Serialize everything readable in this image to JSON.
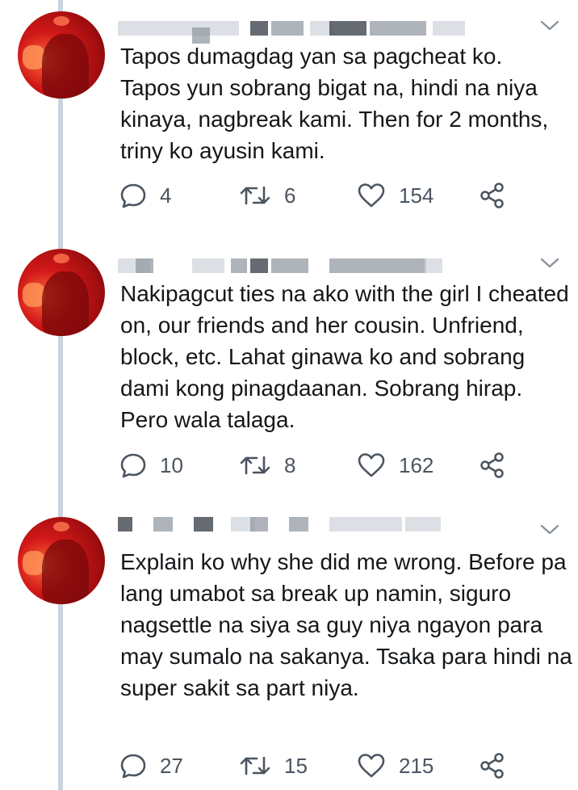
{
  "tweets": [
    {
      "text": "Tapos dumagdag yan sa pagcheat ko.\nTapos yun sobrang bigat na, hindi na niya kinaya, nagbreak kami. Then for 2 months, triny ko ayusin kami.",
      "replies": "4",
      "retweets": "6",
      "likes": "154"
    },
    {
      "text": "Nakipagcut ties na ako with the girl I cheated on, our friends and her cousin. Unfriend, block, etc. Lahat ginawa ko and sobrang dami kong pinagdaanan. Sobrang hirap. Pero wala talaga.",
      "replies": "10",
      "retweets": "8",
      "likes": "162"
    },
    {
      "text": "Explain ko why she did me wrong. Before pa lang umabot sa break up namin, siguro nagsettle na siya sa guy niya ngayon para may sumalo na sakanya. Tsaka para hindi na super sakit sa part niya.",
      "replies": "27",
      "retweets": "15",
      "likes": "215"
    }
  ],
  "icons": {
    "reply": "reply-icon",
    "retweet": "retweet-icon",
    "like": "heart-icon",
    "share": "share-icon",
    "menu": "chevron-down-icon"
  },
  "colors": {
    "thread_line": "#c9d4e0",
    "icon": "#4b5560",
    "text": "#14171a"
  }
}
